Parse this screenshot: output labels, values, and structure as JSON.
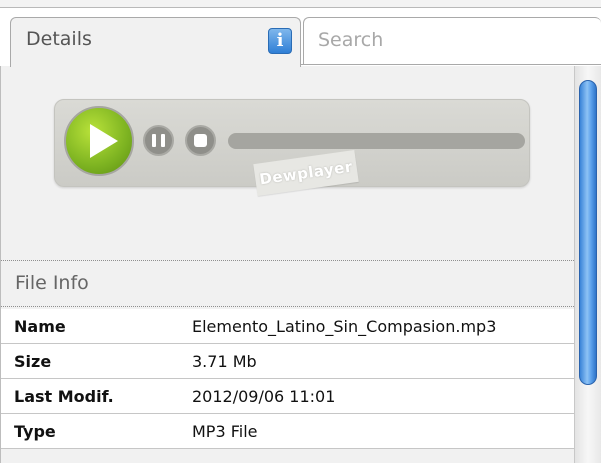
{
  "tabs": {
    "details_label": "Details",
    "info_badge": "i",
    "search_label": "Search"
  },
  "player": {
    "brand": "Dewplayer",
    "progress": 0
  },
  "file_info": {
    "title": "File Info",
    "rows": [
      {
        "key": "Name",
        "value": "Elemento_Latino_Sin_Compasion.mp3"
      },
      {
        "key": "Size",
        "value": "3.71 Mb"
      },
      {
        "key": "Last Modif.",
        "value": "2012/09/06 11:01"
      },
      {
        "key": "Type",
        "value": "MP3 File"
      }
    ]
  },
  "icons": [
    "info-icon",
    "play-icon",
    "pause-icon",
    "stop-icon"
  ],
  "colors": {
    "accent_green": "#7db321",
    "accent_blue": "#2f7fd6",
    "panel_bg": "#f1f1f1"
  }
}
